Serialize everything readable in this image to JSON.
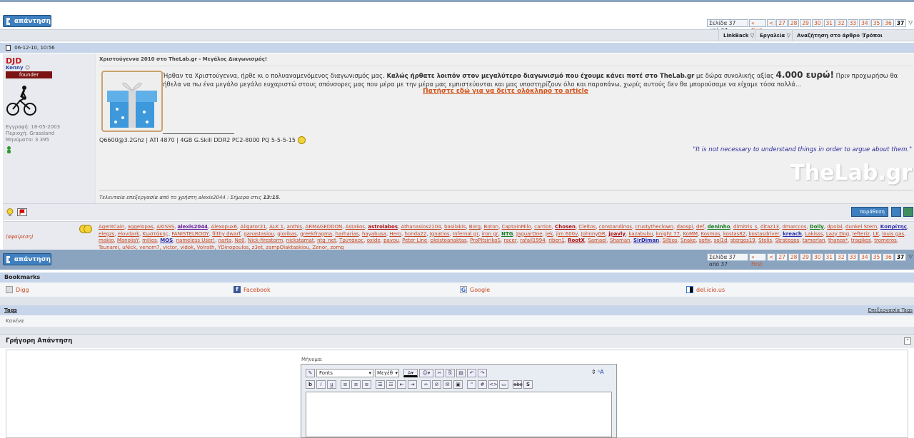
{
  "reply_button_label": "απάντηση",
  "pagination": {
    "info": "Σελίδα 37 από 37",
    "first": "« First",
    "prev": "<",
    "pages": [
      "27",
      "28",
      "29",
      "30",
      "31",
      "32",
      "33",
      "34",
      "35",
      "36",
      "37"
    ],
    "current": "37"
  },
  "menu": [
    "LinkBack",
    "Εργαλεία",
    "Αναζήτηση στο άρθρο",
    "Τρόποι εμφάνισης"
  ],
  "post": {
    "date": "06-12-10, 10:56",
    "username": "DJD",
    "user_title": "Kenny",
    "rank": "founder",
    "joined": "Εγγραφή: 18-05-2003",
    "location": "Περιοχή: Grassland",
    "posts": "Μηνύματα: 3.395",
    "title": "Χριστούγεννα 2010 στο TheLab.gr - Μεγάλος Διαγωνισμός!",
    "body_plain_1": "Ήρθαν τα Χριστούγεννα, ήρθε κι ο πολυαναμενόμενος διαγωνισμός μας. ",
    "body_bold": "Καλώς ήρθατε λοιπόν στον μεγαλύτερο διαγωνισμό που έχουμε κάνει ποτέ στο TheLab.gr",
    "body_plain_2": " με δώρα συνολικής αξίας ",
    "body_amount": "4.000 ευρώ!",
    "body_plain_3": " Πριν προχωρήσω θα ήθελα να πω ένα μεγάλο μεγάλο ευχαριστώ στους σπόνσορες μας που μέρα με την μέρα μας εμπιστεύονται και μας υποστηρίζουν όλο και παραπάνω, χωρίς αυτούς δεν θα μπορούσαμε να είχαμε τόσα πολλά...",
    "article_link": "Πατήστε εδώ για να δείτε ολόκληρο το article",
    "signature": "Q6600@3.2Ghz | ATI 4870 | 4GB G.Skill DDR2 PC2-8000 PQ 5-5-5-15",
    "quote": "\"It is not necessary to understand things in order to argue about them.\"",
    "logo_text": "TheLab.gr",
    "edit_note_prefix": "Τελευταία επεξεργασία από το χρήστη alexis2044 : Σήμερα στις ",
    "edit_time": "13:15",
    "quote_button": "παράθεση"
  },
  "thanks": {
    "remove": "(αφαίρεση)",
    "names": [
      "AgentCain",
      "aggelopas",
      "AKISSS",
      "alexis2044",
      "Alexopux6",
      "Aligator21",
      "ALK 1",
      "anthis",
      "ARMAGEDDON",
      "Astakos",
      "astrolabos",
      "Athanasios2104",
      "basilakis",
      "Borg",
      "Boton",
      "CaptainMilo",
      "carrion",
      "Chosen",
      "Cleitos",
      "constandinos",
      "crustytheclown",
      "daospi",
      "def",
      "deninho",
      "dimitris_s",
      "ditaz13",
      "dmarccos",
      "Dolly",
      "dpolal",
      "dunkel Stern",
      "Κοπρίτης",
      "elegzs",
      "elovdark",
      "Κωστάκης",
      "FANISTELROOY",
      "filthy dwarf",
      "ganastasiou",
      "giorikas",
      "greekfragma",
      "harharias",
      "hayabusa",
      "Hero",
      "honda22",
      "Ignatios",
      "Infernal gr",
      "iron gr",
      "NTG",
      "JaguarOne",
      "jek",
      "jim 600v",
      "JohnnyGR",
      "jpavly",
      "kazabubu",
      "knight 77",
      "KoMM",
      "Kosmos",
      "kostas82",
      "kostasdriver",
      "kreach",
      "Lakisss",
      "Lazy Dog",
      "lefteriz",
      "LK",
      "louis gas",
      "makio",
      "ManolisY",
      "milios",
      "MOS",
      "nameless User!",
      "narta",
      "Ne0",
      "Nick-firestorm",
      "nickstamat",
      "ntg_net",
      "Τρυτάκος",
      "oxide",
      "pavou",
      "Peter Line",
      "pleistoanaktas",
      "ProPitsirikoS",
      "racer",
      "rafail1994",
      "riben1",
      "RootX",
      "Samael",
      "Shaman",
      "SirDiman",
      "Siltios",
      "Snake",
      "sofix",
      "sol1d",
      "stergos19",
      "Stolis",
      "Strategos",
      "tamerlan",
      "thanos*",
      "tragikos",
      "tromeros",
      "Tsunami",
      "uNick",
      "venom7",
      "victor",
      "vidok",
      "Volrath",
      "YDinopoulos",
      "z3et",
      "zampOlaktaskiou",
      "Zenor",
      "zomg"
    ]
  },
  "bookmarks": {
    "header": "Bookmarks",
    "items": [
      "Digg",
      "Facebook",
      "Google",
      "del.icio.us"
    ]
  },
  "tags": {
    "header": "Tags",
    "edit": "Επεξεργασία Tags",
    "value": "Κανένα"
  },
  "quick_reply": {
    "header": "Γρήγορη Απάντηση",
    "message_label": "Μήνυμα:",
    "font_select": "Fonts",
    "size_select": "Μεγέθ"
  }
}
